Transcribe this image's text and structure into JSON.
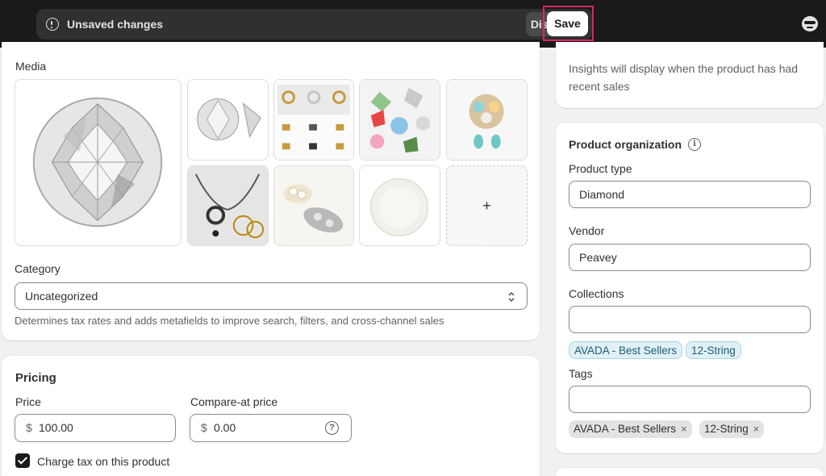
{
  "topbar": {
    "message": "Unsaved changes",
    "discard_label": "Discard",
    "save_label": "Save"
  },
  "media": {
    "title": "Media",
    "add_label": "+"
  },
  "category": {
    "label": "Category",
    "value": "Uncategorized",
    "help": "Determines tax rates and adds metafields to improve search, filters, and cross-channel sales"
  },
  "pricing": {
    "title": "Pricing",
    "price_label": "Price",
    "price_currency": "$",
    "price_value": "100.00",
    "compare_label": "Compare-at price",
    "compare_currency": "$",
    "compare_value": "0.00",
    "charge_tax_label": "Charge tax on this product"
  },
  "insights": {
    "text": "Insights will display when the product has had recent sales"
  },
  "organization": {
    "title": "Product organization",
    "type_label": "Product type",
    "type_value": "Diamond",
    "vendor_label": "Vendor",
    "vendor_value": "Peavey",
    "collections_label": "Collections",
    "collections": [
      "AVADA - Best Sellers",
      "12-String"
    ],
    "tags_label": "Tags",
    "tags": [
      "AVADA - Best Sellers",
      "12-String"
    ],
    "remove_icon": "×"
  },
  "colors": {
    "topbar": "#1a1a1a",
    "save_highlight": "#d6285c",
    "collection_pill": "#e0f0f7"
  }
}
